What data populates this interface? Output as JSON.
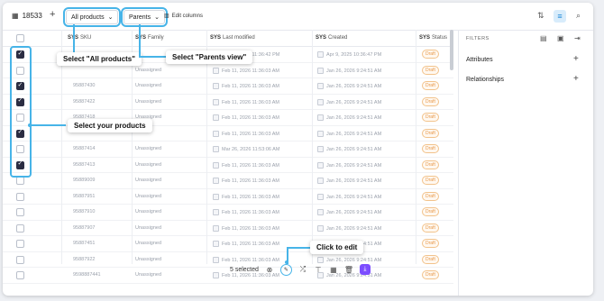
{
  "toolbar": {
    "count": "18533",
    "plus": "+",
    "dropdown_products": "All products",
    "dropdown_view": "Parents",
    "edit_columns": "Edit columns"
  },
  "columns": [
    {
      "prefix": "",
      "label": ""
    },
    {
      "prefix": "SYS",
      "label": "SKU"
    },
    {
      "prefix": "SYS",
      "label": "Family"
    },
    {
      "prefix": "SYS",
      "label": "Last modified"
    },
    {
      "prefix": "SYS",
      "label": "Created"
    },
    {
      "prefix": "SYS",
      "label": "Status"
    }
  ],
  "rows": [
    {
      "checked": true,
      "sku": "",
      "family": "",
      "modified": "Feb 11, 2026 11:36:42 PM",
      "created": "Apr 9, 2025 10:36:47 PM",
      "status": "Draft"
    },
    {
      "checked": false,
      "sku": "",
      "family": "Unassigned",
      "modified": "Feb 11, 2026 11:36:03 AM",
      "created": "Jan 26, 2026 9:24:51 AM",
      "status": "Draft"
    },
    {
      "checked": true,
      "sku": "95887430",
      "family": "Unassigned",
      "modified": "Feb 11, 2026 11:36:03 AM",
      "created": "Jan 26, 2026 9:24:51 AM",
      "status": "Draft"
    },
    {
      "checked": true,
      "sku": "95887422",
      "family": "Unassigned",
      "modified": "Feb 11, 2026 11:36:03 AM",
      "created": "Jan 26, 2026 9:24:51 AM",
      "status": "Draft"
    },
    {
      "checked": false,
      "sku": "95887418",
      "family": "Unassigned",
      "modified": "Feb 11, 2026 11:36:03 AM",
      "created": "Jan 26, 2026 9:24:51 AM",
      "status": "Draft"
    },
    {
      "checked": true,
      "sku": "",
      "family": "",
      "modified": "Feb 11, 2026 11:36:03 AM",
      "created": "Jan 26, 2026 9:24:51 AM",
      "status": "Draft"
    },
    {
      "checked": false,
      "sku": "95887414",
      "family": "Unassigned",
      "modified": "Mar 26, 2026 11:53:06 AM",
      "created": "Jan 26, 2026 9:24:51 AM",
      "status": "Draft"
    },
    {
      "checked": true,
      "sku": "95887413",
      "family": "Unassigned",
      "modified": "Feb 11, 2026 11:36:03 AM",
      "created": "Jan 26, 2026 9:24:51 AM",
      "status": "Draft"
    },
    {
      "checked": false,
      "sku": "95889009",
      "family": "Unassigned",
      "modified": "Feb 11, 2026 11:36:03 AM",
      "created": "Jan 26, 2026 9:24:51 AM",
      "status": "Draft"
    },
    {
      "checked": false,
      "sku": "95887951",
      "family": "Unassigned",
      "modified": "Feb 11, 2026 11:36:03 AM",
      "created": "Jan 26, 2026 9:24:51 AM",
      "status": "Draft"
    },
    {
      "checked": false,
      "sku": "95887910",
      "family": "Unassigned",
      "modified": "Feb 11, 2026 11:36:03 AM",
      "created": "Jan 26, 2026 9:24:51 AM",
      "status": "Draft"
    },
    {
      "checked": false,
      "sku": "95887907",
      "family": "Unassigned",
      "modified": "Feb 11, 2026 11:36:03 AM",
      "created": "Jan 26, 2026 9:24:51 AM",
      "status": "Draft"
    },
    {
      "checked": false,
      "sku": "95887451",
      "family": "Unassigned",
      "modified": "Feb 11, 2026 11:36:03 AM",
      "created": "Jan 26, 2026 9:24:51 AM",
      "status": "Draft"
    },
    {
      "checked": false,
      "sku": "95887922",
      "family": "Unassigned",
      "modified": "Feb 11, 2026 11:36:03 AM",
      "created": "Jan 26, 2026 9:24:51 AM",
      "status": "Draft"
    },
    {
      "checked": false,
      "sku": "9598887441",
      "family": "Unassigned",
      "modified": "Feb 11, 2026 11:36:03 AM",
      "created": "Jan 26, 2026 9:24:51 AM",
      "status": "Draft"
    }
  ],
  "panel": {
    "title": "FILTERS",
    "items": [
      "Attributes",
      "Relationships"
    ]
  },
  "bottom_bar": {
    "selected": "5 selected"
  },
  "callouts": {
    "all_products": "Select \"All products\"",
    "parents_view": "Select \"Parents view\"",
    "select_products": "Select your products",
    "click_edit": "Click to edit"
  },
  "colors": {
    "highlight": "#47b4e8",
    "status_draft": "#e8994a",
    "download_button": "#7c4dff"
  }
}
